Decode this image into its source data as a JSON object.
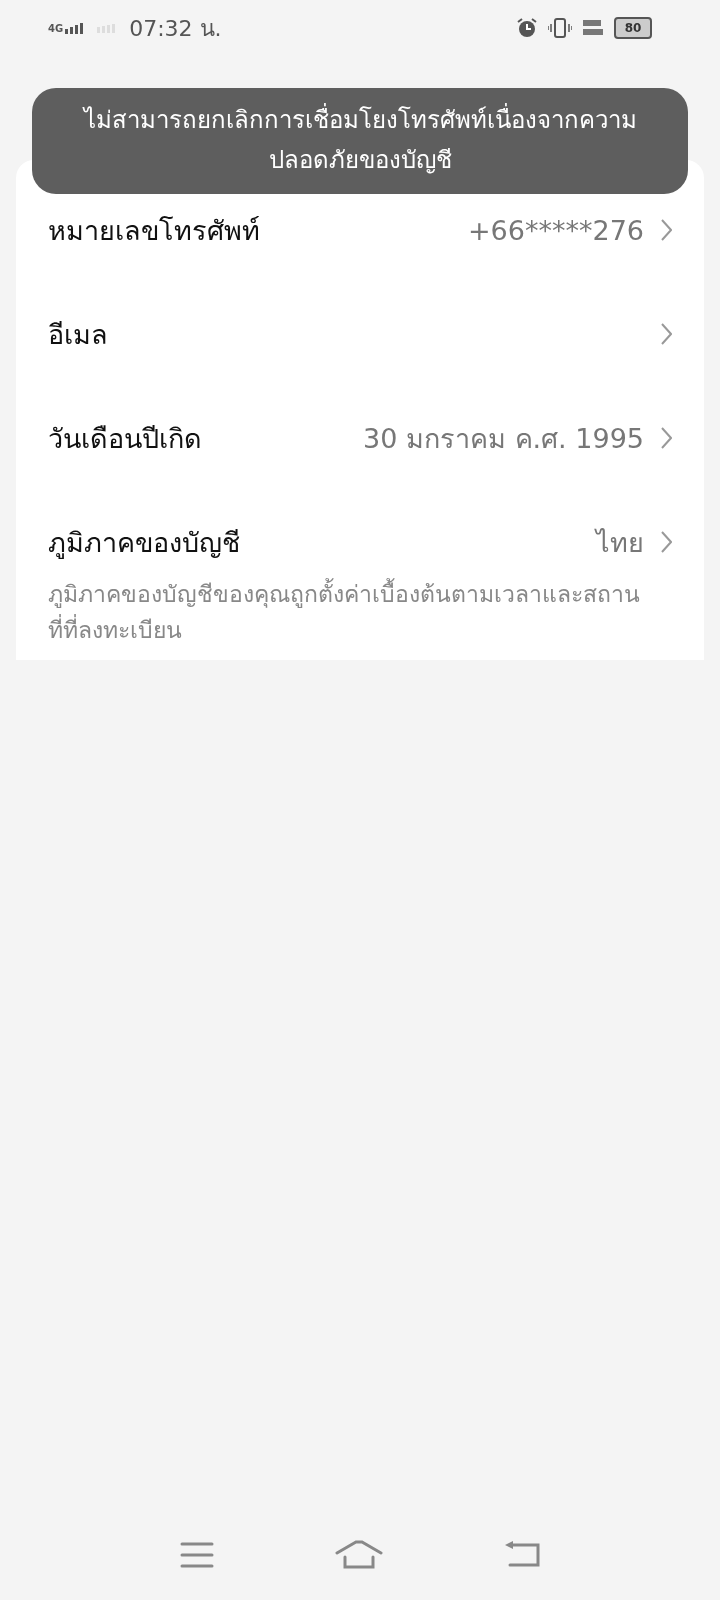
{
  "status_bar": {
    "network": "4G",
    "time": "07:32 น.",
    "battery": "80"
  },
  "toast": {
    "message": "ไม่สามารถยกเลิกการเชื่อมโยงโทรศัพท์เนื่องจากความปลอดภัยของบัญชี"
  },
  "settings": [
    {
      "label": "หมายเลขโทรศัพท์",
      "value": "+66*****276"
    },
    {
      "label": "อีเมล"
    },
    {
      "label": "วันเดือนปีเกิด",
      "value": "30 มกราคม ค.ศ. 1995"
    },
    {
      "label": "ภูมิภาคของบัญชี",
      "value": "ไทย",
      "note": "ภูมิภาคของบัญชีของคุณถูกตั้งค่าเบื้องต้นตามเวลาและสถานที่ที่ลงทะเบียน"
    }
  ]
}
